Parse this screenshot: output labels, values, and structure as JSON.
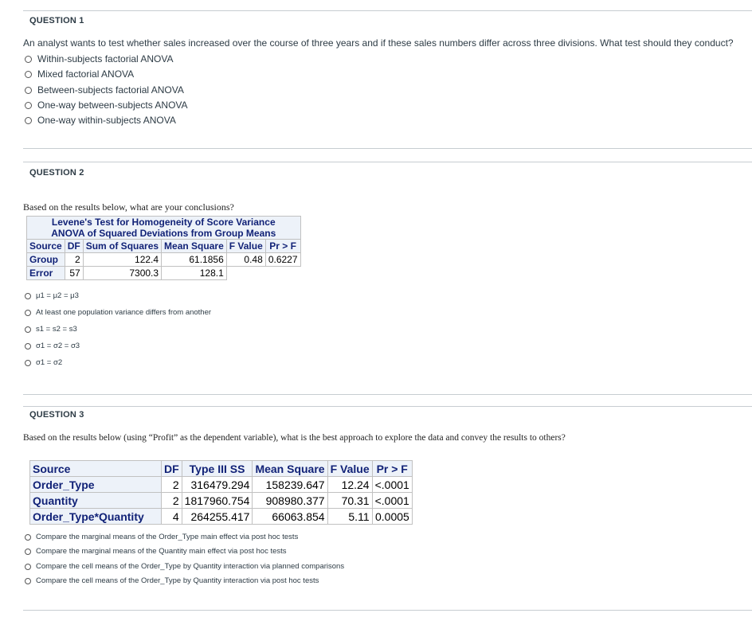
{
  "q1": {
    "header": "QUESTION 1",
    "prompt": "An analyst wants to test whether sales increased over the course of three years and if these sales numbers differ across three divisions. What test should they conduct?",
    "options": [
      "Within-subjects factorial ANOVA",
      "Mixed factorial ANOVA",
      "Between-subjects factorial ANOVA",
      "One-way between-subjects ANOVA",
      "One-way within-subjects ANOVA"
    ]
  },
  "q2": {
    "header": "QUESTION 2",
    "prompt": "Based on the results below, what are your conclusions?",
    "table": {
      "title1": "Levene's Test for Homogeneity of Score Variance",
      "title2": "ANOVA of Squared Deviations from Group Means",
      "columns": [
        "Source",
        "DF",
        "Sum of Squares",
        "Mean Square",
        "F Value",
        "Pr > F"
      ],
      "rows": [
        [
          "Group",
          "2",
          "122.4",
          "61.1856",
          "0.48",
          "0.6227"
        ],
        [
          "Error",
          "57",
          "7300.3",
          "128.1",
          "",
          ""
        ]
      ]
    },
    "options": [
      "μ1 = μ2 = μ3",
      "At least one population variance differs from another",
      "s1 = s2 = s3",
      "σ1 = σ2 = σ3",
      "σ1 = σ2"
    ]
  },
  "q3": {
    "header": "QUESTION 3",
    "prompt": "Based on the results below (using “Profit” as the dependent variable), what is the best approach to explore the data and convey the results to others?",
    "table": {
      "columns": [
        "Source",
        "DF",
        "Type III SS",
        "Mean Square",
        "F Value",
        "Pr > F"
      ],
      "rows": [
        [
          "Order_Type",
          "2",
          "316479.294",
          "158239.647",
          "12.24",
          "<.0001"
        ],
        [
          "Quantity",
          "2",
          "1817960.754",
          "908980.377",
          "70.31",
          "<.0001"
        ],
        [
          "Order_Type*Quantity",
          "4",
          "264255.417",
          "66063.854",
          "5.11",
          "0.0005"
        ]
      ]
    },
    "options": [
      "Compare the marginal means of the Order_Type main effect via post hoc tests",
      "Compare the marginal means of the Quantity main effect via post hoc tests",
      "Compare the cell means of the Order_Type by Quantity interaction via planned comparisons",
      "Compare the cell means of the Order_Type by Quantity interaction via post hoc tests"
    ]
  }
}
